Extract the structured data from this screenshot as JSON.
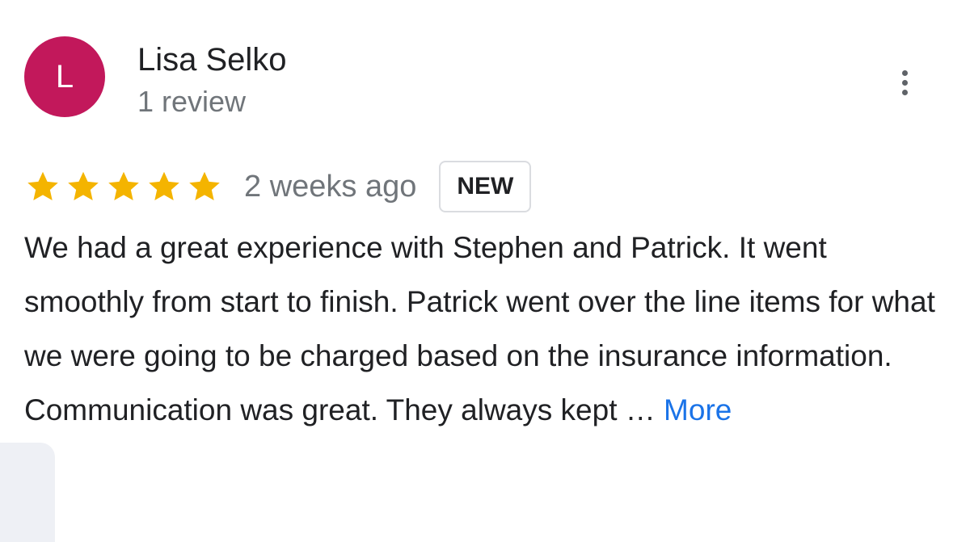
{
  "review": {
    "avatar_letter": "L",
    "avatar_color": "#c2185b",
    "reviewer_name": "Lisa Selko",
    "review_count": "1 review",
    "rating": 5,
    "rating_max": 5,
    "star_color": "#f4b400",
    "date": "2 weeks ago",
    "badge": "NEW",
    "text": "We had a great experience with Stephen and Patrick. It went smoothly from start to finish. Patrick went over the line items for what we were going to be charged based on the insurance information. Communication was great. They always kept",
    "ellipsis": " … ",
    "more_label": "More",
    "menu_icon": "more-vert-icon"
  }
}
